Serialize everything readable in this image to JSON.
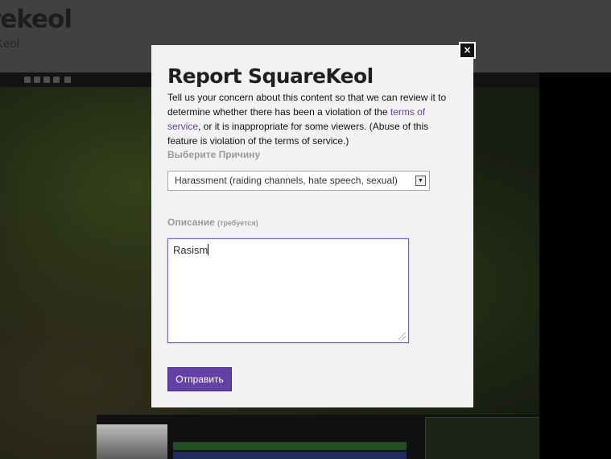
{
  "background": {
    "channel_title": "arekeol",
    "channel_subtitle": "Keol"
  },
  "modal": {
    "close_label": "×",
    "title": "Report SquareKeol",
    "description_before": "Tell us your concern about this content so that we can review it to determine whether there has been a violation of the ",
    "terms_link": "terms of service",
    "description_after": ", or it is inappropriate for some viewers. (Abuse of this feature is violation of the terms of service.)",
    "reason_label": "Выберите Причину",
    "reason_selected": "Harassment (raiding channels, hate speech, sexual)",
    "description_label": "Описание",
    "description_required": "(требуется)",
    "description_value": "Rasism",
    "submit_label": "Отправить"
  },
  "colors": {
    "accent": "#6441a5",
    "modal_background": "#f2f2f2",
    "label_gray": "#9a9a9a"
  },
  "icons": {
    "close": "close-icon",
    "dropdown": "chevron-down-icon",
    "resize": "resize-grip-icon"
  }
}
